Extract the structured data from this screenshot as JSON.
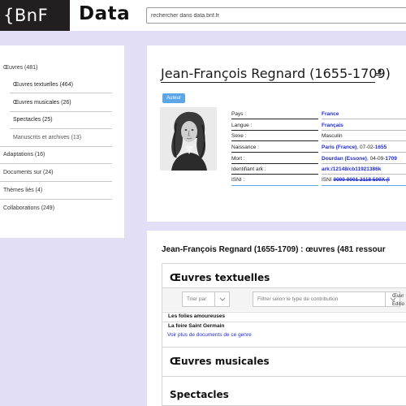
{
  "header": {
    "logo_bnf": "{BnF",
    "logo_data": "Data",
    "search_placeholder": "rechercher dans data.bnf.fr"
  },
  "sidebar": {
    "items": [
      {
        "label": "Œuvres (481)"
      },
      {
        "label": "Œuvres textuelles (464)"
      },
      {
        "label": "Œuvres musicales (26)"
      },
      {
        "label": "Spectacles (25)"
      },
      {
        "label": "Manuscrits et archives (13)"
      },
      {
        "label": "Adaptations (16)"
      },
      {
        "label": "Documents sur (24)"
      },
      {
        "label": "Thèmes liés (4)"
      },
      {
        "label": "Collaborations (249)"
      }
    ]
  },
  "author": {
    "name": "Jean-François Regnard (1655-1709)",
    "badge": "Auteur",
    "fields": [
      {
        "label": "Pays :",
        "value": "France"
      },
      {
        "label": "Langue :",
        "value": "Français"
      },
      {
        "label": "Sexe :",
        "value": "Masculin"
      },
      {
        "label": "Naissance :",
        "value_link": "Paris (France)",
        "value_rest": ", 07-02-",
        "value_link2": "1655"
      },
      {
        "label": "Mort :",
        "value_link": "Dourdan (Essone)",
        "value_rest": ", 04-09-",
        "value_link2": "1709"
      },
      {
        "label": "Identifiant ark :",
        "value": "ark:/12148/cb11921386k"
      },
      {
        "label": "ISNI :",
        "value_prefix": "ISNI ",
        "value": "0000 0001 2118 509X (I"
      }
    ]
  },
  "works": {
    "heading": "Jean-François Regnard (1655-1709) : œuvres (481 ressour",
    "sections": [
      {
        "title": "Œuvres textuelles"
      },
      {
        "title": "Œuvres musicales"
      },
      {
        "title": "Spectacles"
      }
    ],
    "sort_placeholder": "Trier par",
    "filter_placeholder": "Filtrer selon le type de contribution",
    "col_oeuvre": "Œuvr",
    "col_edition": "Éditio",
    "rows": [
      {
        "title": "Les folies amoureuses"
      },
      {
        "title": "La foire Saint Germain"
      }
    ],
    "more_link": "Voir plus de documents de ce genre"
  },
  "colors": {
    "accent_blue": "#1f2bd6",
    "badge_blue": "#5aa6e8",
    "background": "#e2def6"
  }
}
